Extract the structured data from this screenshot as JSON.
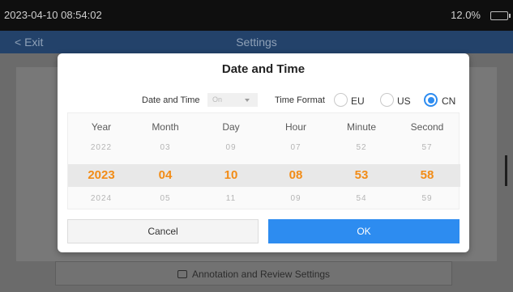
{
  "status_bar": {
    "time": "2023-04-10 08:54:02",
    "battery": "12.0%"
  },
  "app_bar": {
    "back_label": "< Exit",
    "title": "Settings"
  },
  "background": {
    "annotation_button": "Annotation and Review Settings"
  },
  "dialog": {
    "title": "Date and Time",
    "date_time_label": "Date and Time",
    "date_time_select_value": "On",
    "time_format_label": "Time Format",
    "time_format_options": [
      {
        "label": "EU",
        "selected": false
      },
      {
        "label": "US",
        "selected": false
      },
      {
        "label": "CN",
        "selected": true
      }
    ],
    "picker": {
      "headers": [
        "Year",
        "Month",
        "Day",
        "Hour",
        "Minute",
        "Second"
      ],
      "previous": [
        "2022",
        "03",
        "09",
        "07",
        "52",
        "57"
      ],
      "current": [
        "2023",
        "04",
        "10",
        "08",
        "53",
        "58"
      ],
      "next": [
        "2024",
        "05",
        "11",
        "09",
        "54",
        "59"
      ]
    },
    "cancel_label": "Cancel",
    "ok_label": "OK"
  },
  "colors": {
    "accent": "#2d8cf0",
    "highlight": "#f28c17",
    "header": "#23426a"
  }
}
